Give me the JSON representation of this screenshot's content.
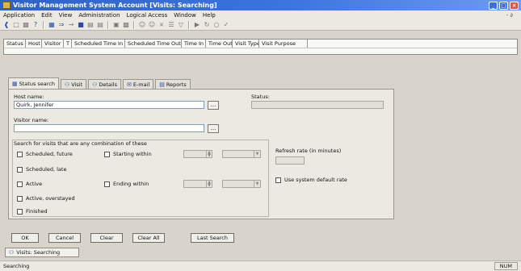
{
  "window": {
    "title": "Visitor Management   System Account   [Visits: Searching]",
    "buttons": [
      "_",
      "□",
      "×"
    ]
  },
  "menu": {
    "items": [
      "Application",
      "Edit",
      "View",
      "Administration",
      "Logical Access",
      "Window",
      "Help"
    ],
    "right": "- ∂"
  },
  "toolbar": {
    "icons": [
      "back-icon",
      "new-icon",
      "print-icon",
      "help-icon",
      "|",
      "grid-icon",
      "forward-icon",
      "arrow-icon",
      "person-icon",
      "card-icon",
      "card2-icon",
      "|",
      "calendar-icon",
      "printer-icon",
      "|",
      "user-add-icon",
      "user-remove-icon",
      "delete-icon",
      "list-icon",
      "filter-icon",
      "|",
      "tool-icon",
      "refresh-icon",
      "find-icon",
      "check-icon"
    ]
  },
  "grid": {
    "columns": [
      "Status",
      "Host",
      "Visitor",
      "T",
      "Scheduled Time In",
      "Scheduled Time Out",
      "Time In",
      "Time Out",
      "Visit Type",
      "Visit Purpose"
    ]
  },
  "tabs": [
    {
      "label": "Status search",
      "icon": "search-icon",
      "selected": true
    },
    {
      "label": "Visit",
      "icon": "people-icon",
      "selected": false
    },
    {
      "label": "Details",
      "icon": "people-icon",
      "selected": false
    },
    {
      "label": "E-mail",
      "icon": "mail-icon",
      "selected": false
    },
    {
      "label": "Reports",
      "icon": "report-icon",
      "selected": false
    }
  ],
  "form": {
    "host_label": "Host name:",
    "host_value": "Quirk, Jennifer",
    "visitor_label": "Visitor name:",
    "visitor_value": "",
    "browse_label": "...",
    "status_label": "Status:",
    "search_group_label": "Search for visits that are any combination of these",
    "checkboxes": {
      "scheduled_future": "Scheduled, future",
      "scheduled_late": "Scheduled, late",
      "active": "Active",
      "active_overstayed": "Active, overstayed",
      "finished": "Finished",
      "starting_within": "Starting within",
      "ending_within": "Ending within"
    },
    "refresh_label": "Refresh rate (in minutes)",
    "use_default_label": "Use system default rate"
  },
  "buttons": {
    "ok": "OK",
    "cancel": "Cancel",
    "clear": "Clear",
    "clear_all": "Clear All",
    "last_search": "Last Search"
  },
  "doc_tab": {
    "label": "Visits: Searching"
  },
  "status_bar": {
    "left": "Searching",
    "right": "NUM"
  }
}
